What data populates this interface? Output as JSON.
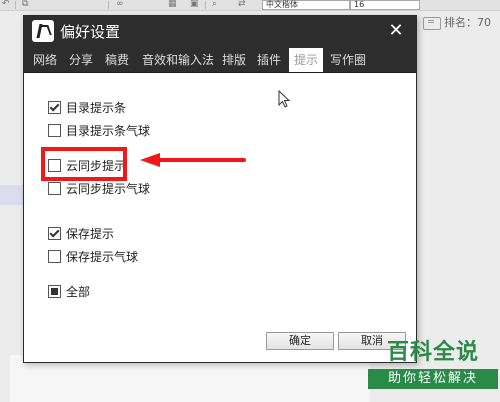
{
  "background_app": {
    "font_select": "中文楷体",
    "size_select": "16",
    "rank_label": "排名：70"
  },
  "dialog": {
    "title": "偏好设置",
    "close_glyph": "✕",
    "tabs": [
      {
        "label": "网络"
      },
      {
        "label": "分享"
      },
      {
        "label": "稿费"
      },
      {
        "label": "音效和输入法"
      },
      {
        "label": "排版"
      },
      {
        "label": "插件"
      },
      {
        "label": "提示",
        "active": true
      },
      {
        "label": "写作圈"
      }
    ],
    "options": [
      {
        "label": "目录提示条",
        "checked": true
      },
      {
        "label": "目录提示条气球",
        "checked": false
      },
      {
        "label": "云同步提示",
        "checked": false
      },
      {
        "label": "云同步提示气球",
        "checked": false
      },
      {
        "label": "保存提示",
        "checked": true
      },
      {
        "label": "保存提示气球",
        "checked": false
      },
      {
        "label": "全部",
        "state": "partial"
      }
    ],
    "ok_label": "确定",
    "cancel_label": "取消"
  },
  "annotation": {
    "highlight_color": "#f21818"
  },
  "watermark": {
    "main": "百科全说",
    "sub": "助你轻松解决"
  }
}
